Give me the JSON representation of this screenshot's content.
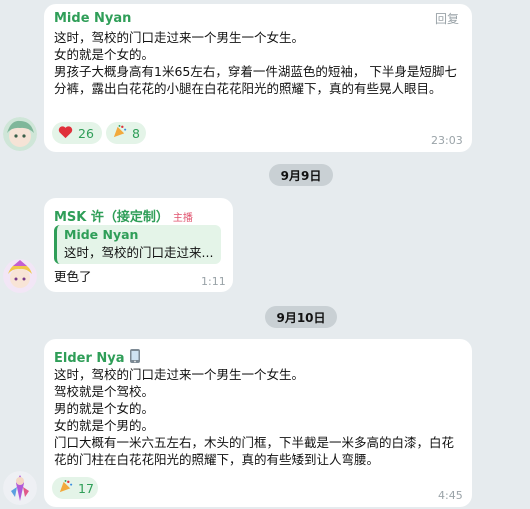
{
  "messages": [
    {
      "sender": "Mide Nyan",
      "reply_label": "回复",
      "lines": [
        "这时，驾校的门口走过来一个男生一个女生。",
        "女的就是个女的。",
        "男孩子大概身高有1米65左右，穿着一件湖蓝色的短袖，  下半身是短脚七分裤，露出白花花的小腿在白花花阳光的照耀下，真的有些晃人眼目。"
      ],
      "reactions": [
        {
          "icon": "heart-icon",
          "count": "26"
        },
        {
          "icon": "party-icon",
          "count": "8"
        }
      ],
      "time": "23:03"
    },
    {
      "sender": "MSK 许（接定制）",
      "badge": "主播",
      "quote": {
        "name": "Mide Nyan",
        "text": "这时，驾校的门口走过来..."
      },
      "lines": [
        "更色了"
      ],
      "time": "1:11"
    },
    {
      "sender": "Elder Nya",
      "lines": [
        "这时，驾校的门口走过来一个男生一个女生。",
        "驾校就是个驾校。",
        "男的就是个女的。",
        "女的就是个男的。",
        "门口大概有一米六五左右，木头的门框，下半截是一米多高的白漆，白花花的门柱在白花花阳光的照耀下，真的有些矮到让人弯腰。"
      ],
      "reactions": [
        {
          "icon": "party-icon",
          "count": "17"
        }
      ],
      "time": "4:45"
    }
  ],
  "dates": [
    "9月9日",
    "9月10日"
  ],
  "colors": {
    "accent": "#2f9e58",
    "background": "#e6ebee",
    "bubble": "#ffffff",
    "reaction_bg": "#e4f4e8"
  }
}
